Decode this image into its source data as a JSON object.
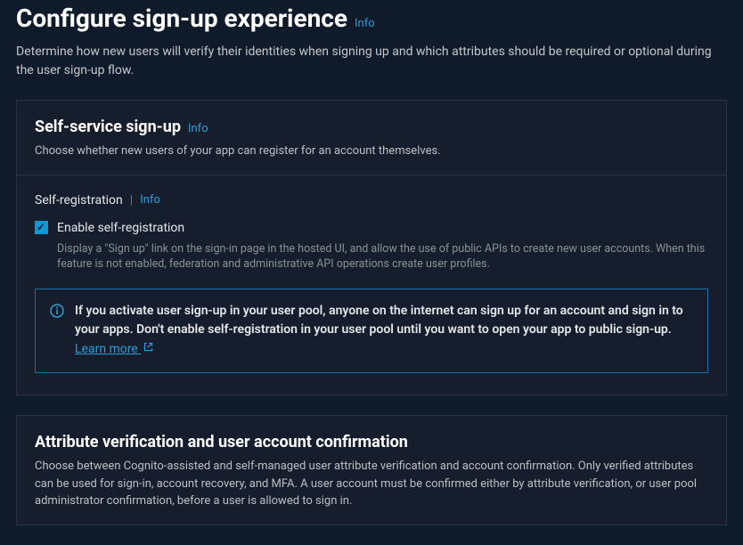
{
  "page": {
    "title": "Configure sign-up experience",
    "info": "Info",
    "desc": "Determine how new users will verify their identities when signing up and which attributes should be required or optional during the user sign-up flow."
  },
  "panel1": {
    "title": "Self-service sign-up",
    "info": "Info",
    "desc": "Choose whether new users of your app can register for an account themselves.",
    "section_label": "Self-registration",
    "section_info": "Info",
    "checkbox_label": "Enable self-registration",
    "checkbox_desc": "Display a \"Sign up\" link on the sign-in page in the hosted UI, and allow the use of public APIs to create new user accounts. When this feature is not enabled, federation and administrative API operations create user profiles.",
    "alert_text": "If you activate user sign-up in your user pool, anyone on the internet can sign up for an account and sign in to your apps. Don't enable self-registration in your user pool until you want to open your app to public sign-up.",
    "learn_more": "Learn more"
  },
  "panel2": {
    "title": "Attribute verification and user account confirmation",
    "desc": "Choose between Cognito-assisted and self-managed user attribute verification and account confirmation. Only verified attributes can be used for sign-in, account recovery, and MFA. A user account must be confirmed either by attribute verification, or user pool administrator confirmation, before a user is allowed to sign in."
  }
}
